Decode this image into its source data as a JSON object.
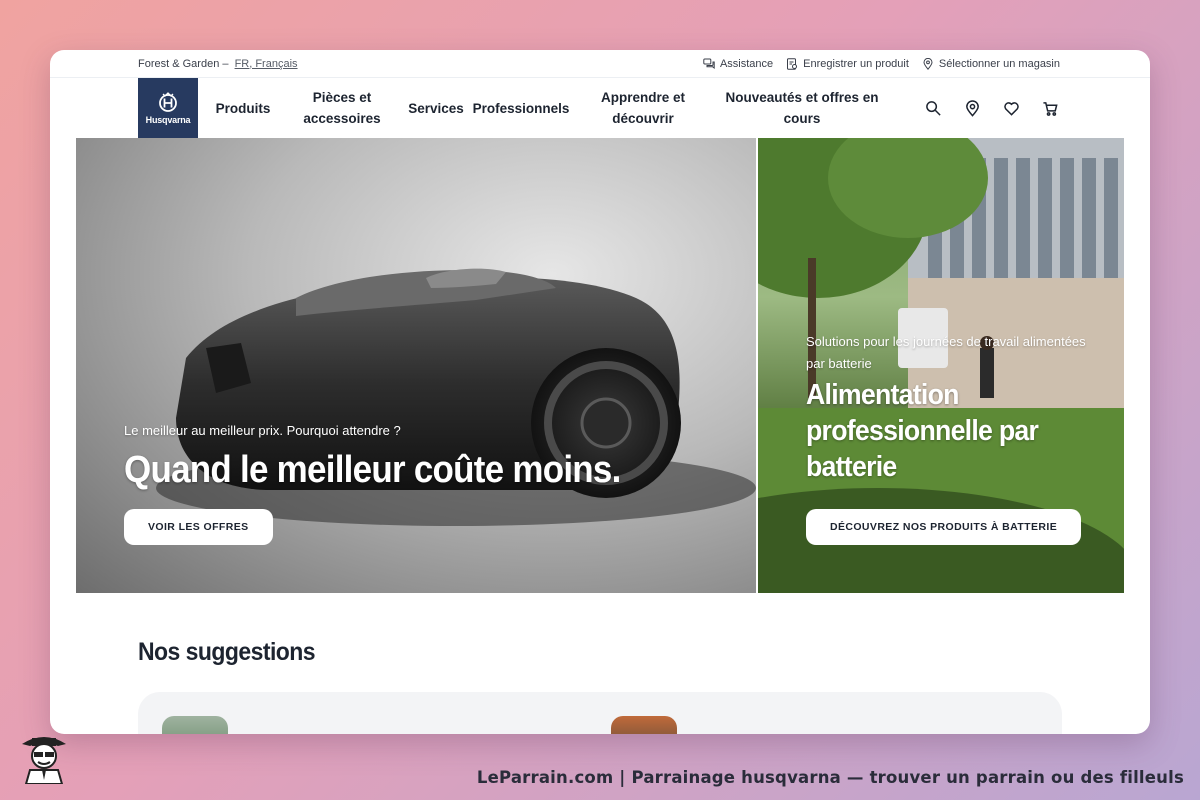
{
  "utility": {
    "brand_label": "Forest & Garden –",
    "language": "FR, Français",
    "links": [
      {
        "label": "Assistance",
        "icon": "chat-icon"
      },
      {
        "label": "Enregistrer un produit",
        "icon": "register-icon"
      },
      {
        "label": "Sélectionner un magasin",
        "icon": "location-pin-icon"
      }
    ]
  },
  "logo": {
    "text": "Husqvarna",
    "bg": "#273a60"
  },
  "nav": {
    "items": [
      {
        "label": "Produits"
      },
      {
        "label": "Pièces et accessoires"
      },
      {
        "label": "Services"
      },
      {
        "label": "Professionnels"
      },
      {
        "label": "Apprendre et découvrir"
      },
      {
        "label": "Nouveautés et offres en cours"
      }
    ],
    "icons": [
      "search-icon",
      "location-pin-icon",
      "heart-icon",
      "cart-icon"
    ]
  },
  "hero": {
    "left": {
      "eyebrow": "Le meilleur au meilleur prix. Pourquoi attendre ?",
      "title": "Quand le meilleur coûte moins.",
      "cta": "VOIR LES OFFRES"
    },
    "right": {
      "eyebrow": "Solutions pour les journées de travail alimentées par batterie",
      "title": "Alimentation professionnelle par batterie",
      "cta": "DÉCOUVREZ NOS PRODUITS À BATTERIE"
    }
  },
  "suggestions": {
    "title": "Nos suggestions"
  },
  "footer": {
    "text": "LeParrain.com | Parrainage husqvarna — trouver un parrain ou des filleuls"
  }
}
